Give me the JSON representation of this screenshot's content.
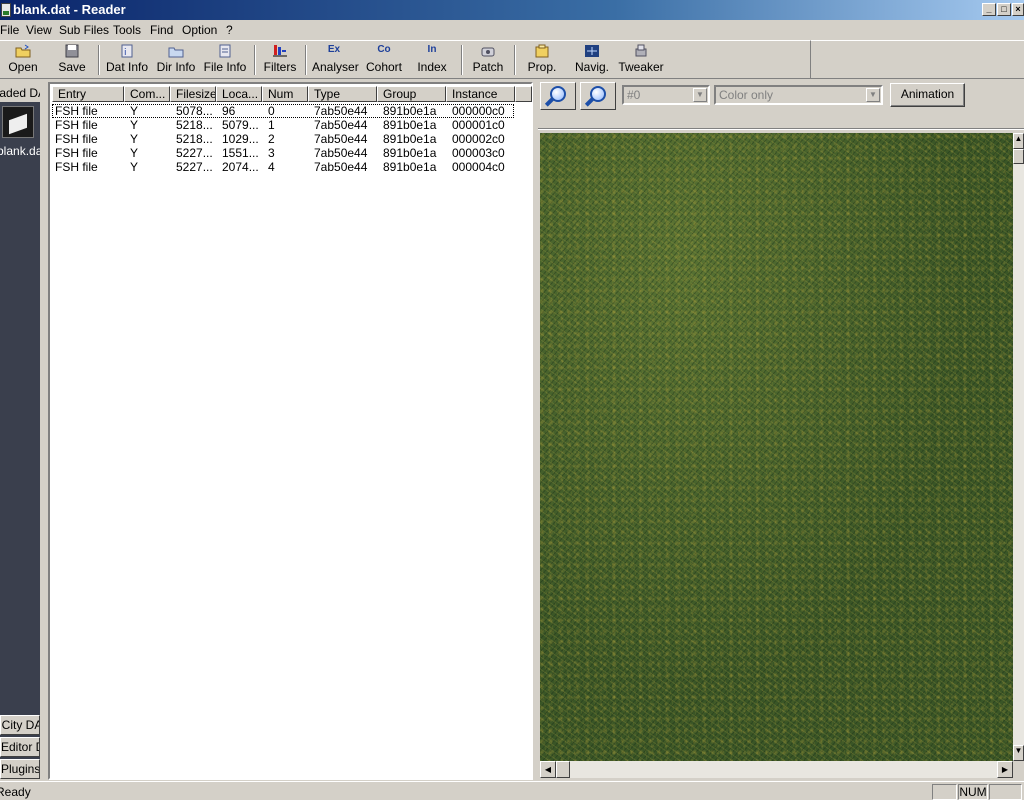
{
  "window": {
    "title": "blank.dat - Reader",
    "controls": {
      "minimize": "_",
      "maximize": "□",
      "close": "×"
    }
  },
  "menu": [
    "File",
    "View",
    "Sub Files",
    "Tools",
    "Find",
    "Option",
    "?"
  ],
  "toolbar": {
    "buttons": [
      {
        "label": "Open",
        "icon": "open-folder-icon"
      },
      {
        "label": "Save",
        "icon": "save-disk-icon"
      },
      {
        "label": "Dat Info",
        "icon": "dat-info-icon"
      },
      {
        "label": "Dir Info",
        "icon": "dir-info-icon"
      },
      {
        "label": "File Info",
        "icon": "file-info-icon"
      },
      {
        "label": "Filters",
        "icon": "filters-icon"
      },
      {
        "label": "Analyser",
        "icon": "analyser-icon",
        "glyph": "Ex"
      },
      {
        "label": "Cohort",
        "icon": "cohort-icon",
        "glyph": "Co"
      },
      {
        "label": "Index",
        "icon": "index-icon",
        "glyph": "In"
      },
      {
        "label": "Patch",
        "icon": "patch-icon"
      },
      {
        "label": "Prop.",
        "icon": "properties-icon"
      },
      {
        "label": "Navig.",
        "icon": "navigator-icon"
      },
      {
        "label": "Tweaker",
        "icon": "tweaker-icon"
      }
    ]
  },
  "left_dock": {
    "header": "Loaded DATs",
    "item": {
      "label": "blank.dat",
      "icon": "dat-file-icon"
    },
    "tabs": [
      "SimCity DATs",
      "Editor DATs",
      "Plugins"
    ]
  },
  "list": {
    "columns": [
      "Entry",
      "Com...",
      "Filesize",
      "Loca...",
      "Num",
      "Type",
      "Group",
      "Instance"
    ],
    "rows": [
      [
        "FSH file",
        "Y",
        "5078...",
        "96",
        "0",
        "7ab50e44",
        "891b0e1a",
        "000000c0"
      ],
      [
        "FSH file",
        "Y",
        "5218...",
        "5079...",
        "1",
        "7ab50e44",
        "891b0e1a",
        "000001c0"
      ],
      [
        "FSH file",
        "Y",
        "5218...",
        "1029...",
        "2",
        "7ab50e44",
        "891b0e1a",
        "000002c0"
      ],
      [
        "FSH file",
        "Y",
        "5227...",
        "1551...",
        "3",
        "7ab50e44",
        "891b0e1a",
        "000003c0"
      ],
      [
        "FSH file",
        "Y",
        "5227...",
        "2074...",
        "4",
        "7ab50e44",
        "891b0e1a",
        "000004c0"
      ]
    ]
  },
  "preview": {
    "image_combo": "#0",
    "mode_combo": "Color only",
    "animation_label": "Animation",
    "zoom_in_icon": "zoom-in-icon",
    "zoom_out_icon": "zoom-out-icon",
    "texture_color": "#44602a"
  },
  "status": {
    "text": "Ready",
    "num": "NUM"
  }
}
